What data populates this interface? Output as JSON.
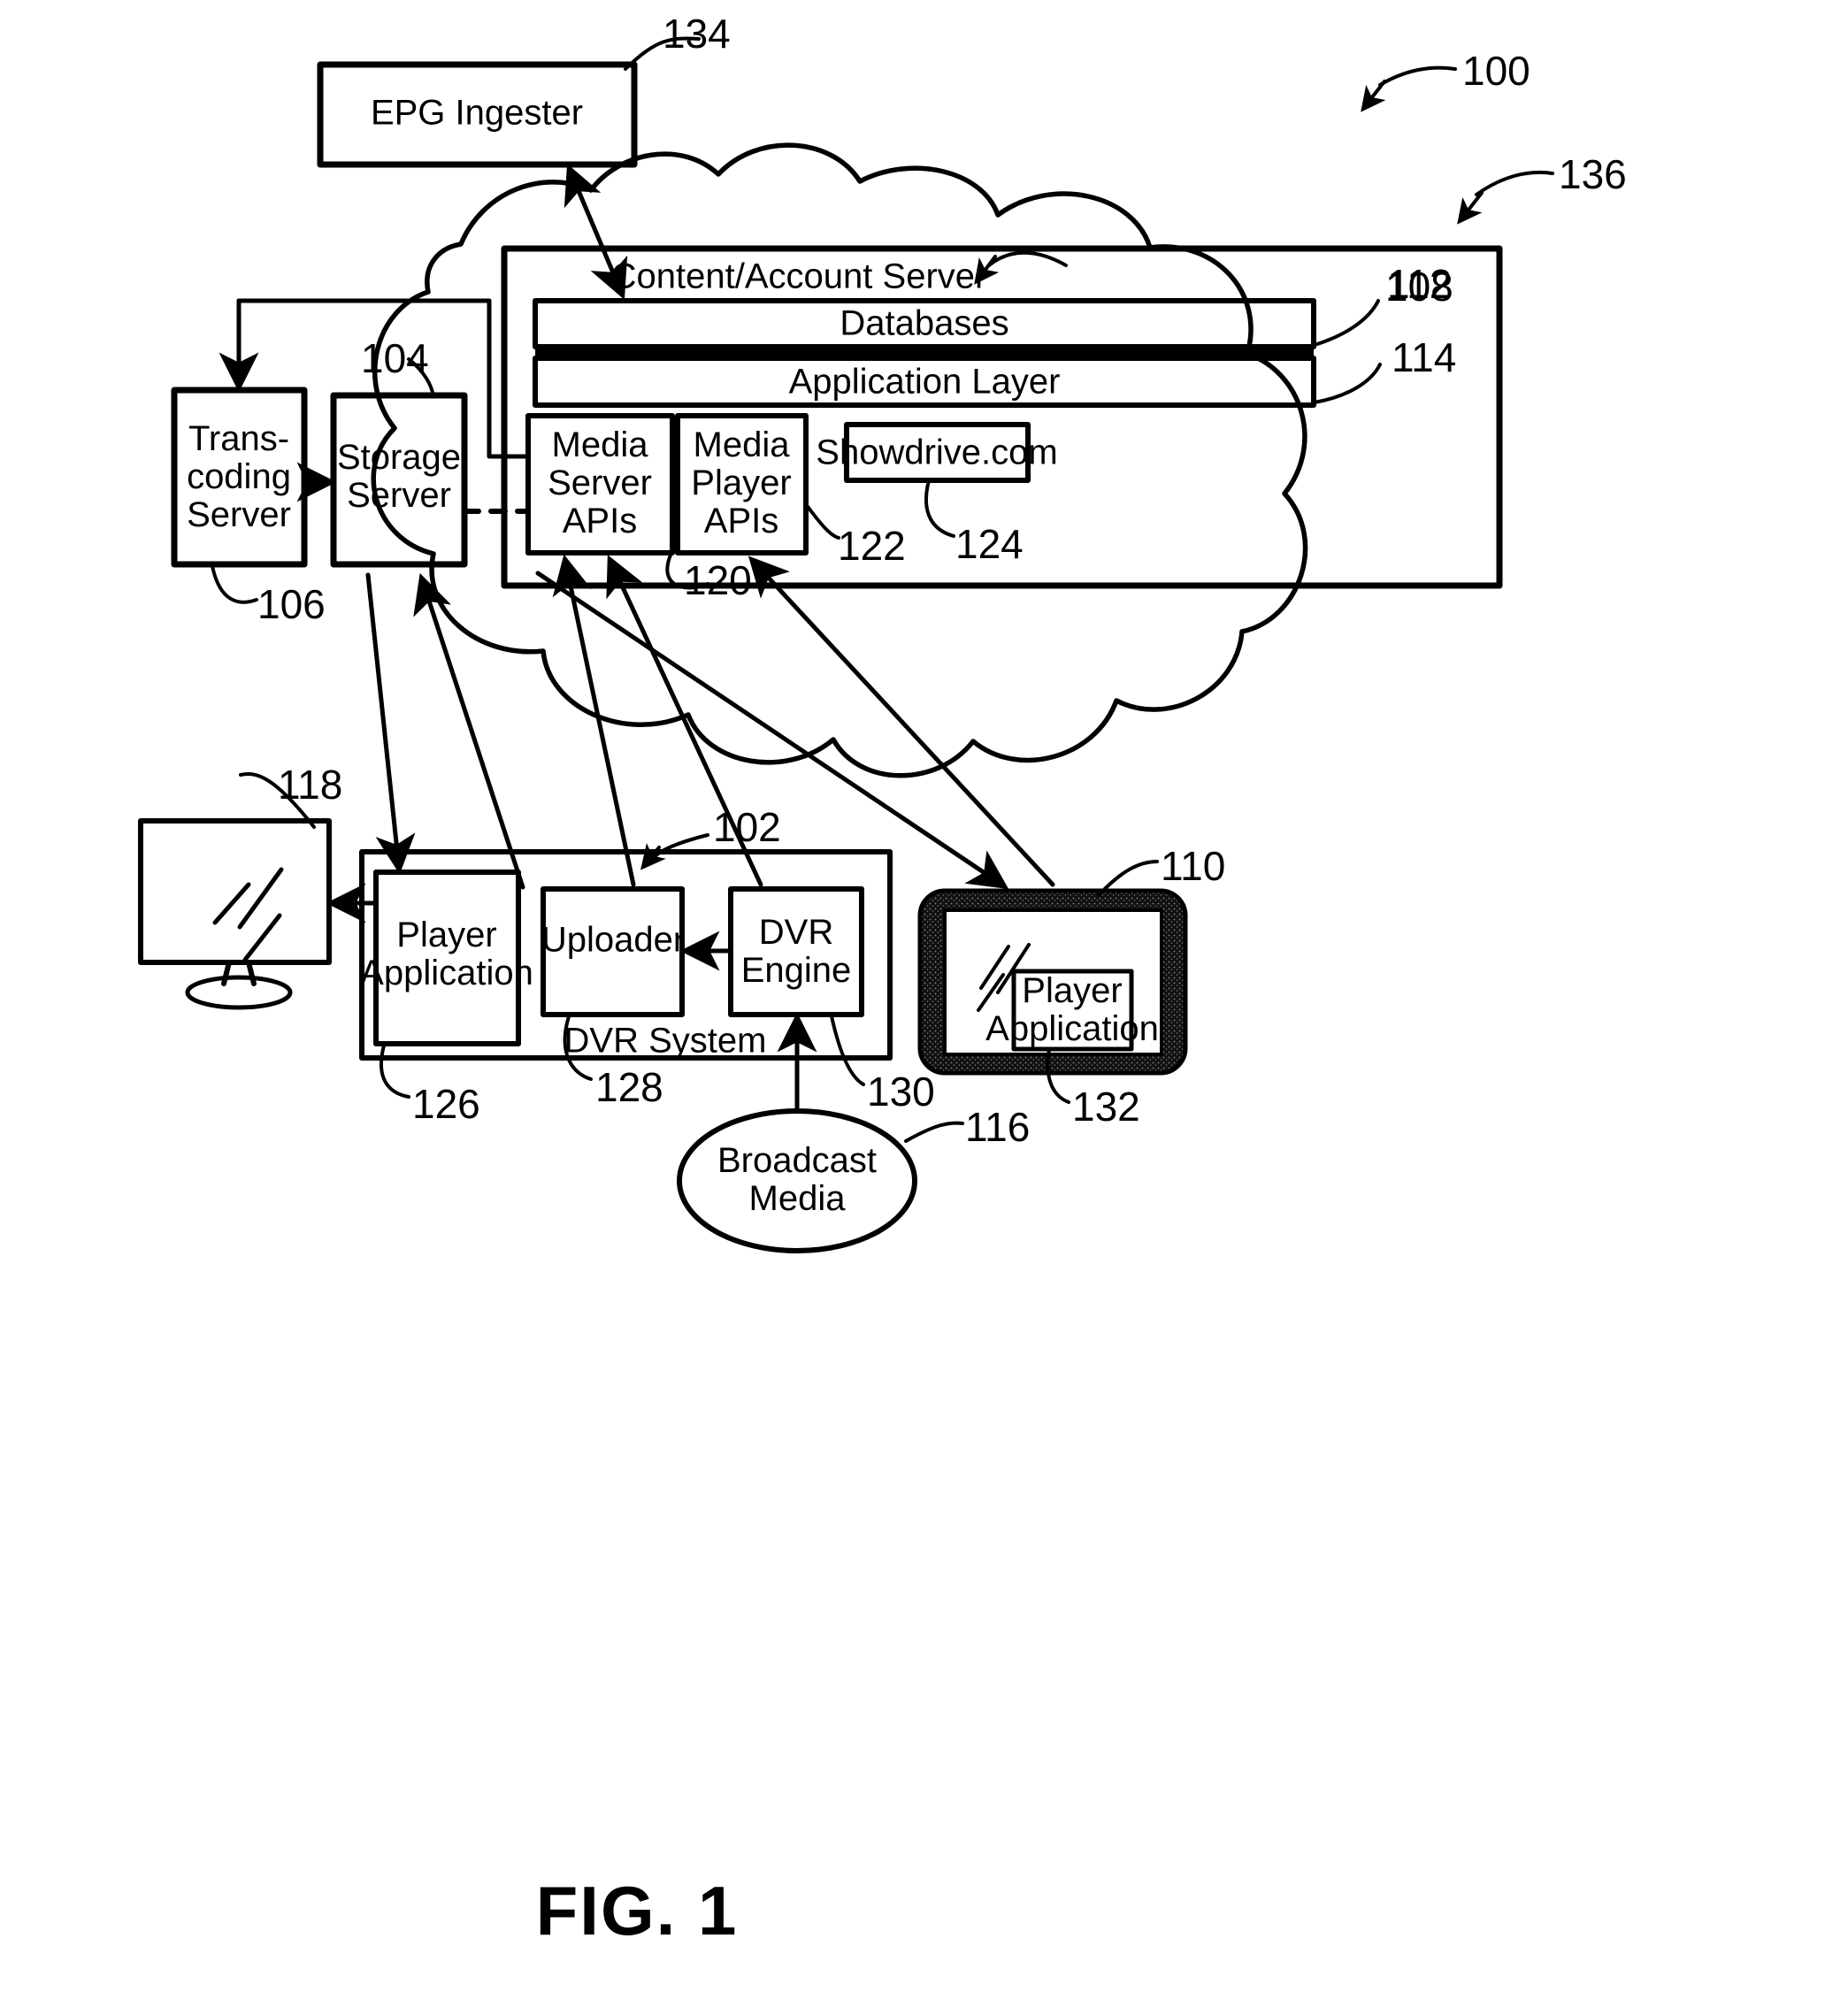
{
  "figure": {
    "caption": "FIG. 1",
    "system_ref": "100"
  },
  "nodes": {
    "epg_ingester": {
      "label": "EPG Ingester",
      "ref": "134"
    },
    "cloud": {
      "ref": "136"
    },
    "content_account_server": {
      "label": "Content/Account Server",
      "ref": "108"
    },
    "databases": {
      "label": "Databases",
      "ref": "112"
    },
    "application_layer": {
      "label": "Application Layer",
      "ref": "114"
    },
    "media_server_apis": {
      "label": "Media\nServer\nAPIs",
      "ref": "120"
    },
    "media_player_apis": {
      "label": "Media\nPlayer\nAPIs",
      "ref": "122"
    },
    "showdrive": {
      "label": "Showdrive.com",
      "ref": "124"
    },
    "transcoding_server": {
      "label": "Trans-\ncoding\nServer",
      "ref": "106"
    },
    "storage_server": {
      "label": "Storage\nServer",
      "ref": "104"
    },
    "monitor": {
      "ref": "118"
    },
    "dvr_system": {
      "label": "DVR System",
      "ref": "102"
    },
    "player_application_dvr": {
      "label": "Player\nApplication",
      "ref": "126"
    },
    "uploader": {
      "label": "Uploader",
      "ref": "128"
    },
    "dvr_engine": {
      "label": "DVR\nEngine",
      "ref": "130"
    },
    "broadcast_media": {
      "label": "Broadcast\nMedia",
      "ref": "116"
    },
    "tablet": {
      "ref": "110"
    },
    "player_application_tablet": {
      "label": "Player\nApplication",
      "ref": "132"
    }
  },
  "colors": {
    "line": "#000000",
    "background": "#ffffff",
    "bezel": "#1a1a1a"
  }
}
